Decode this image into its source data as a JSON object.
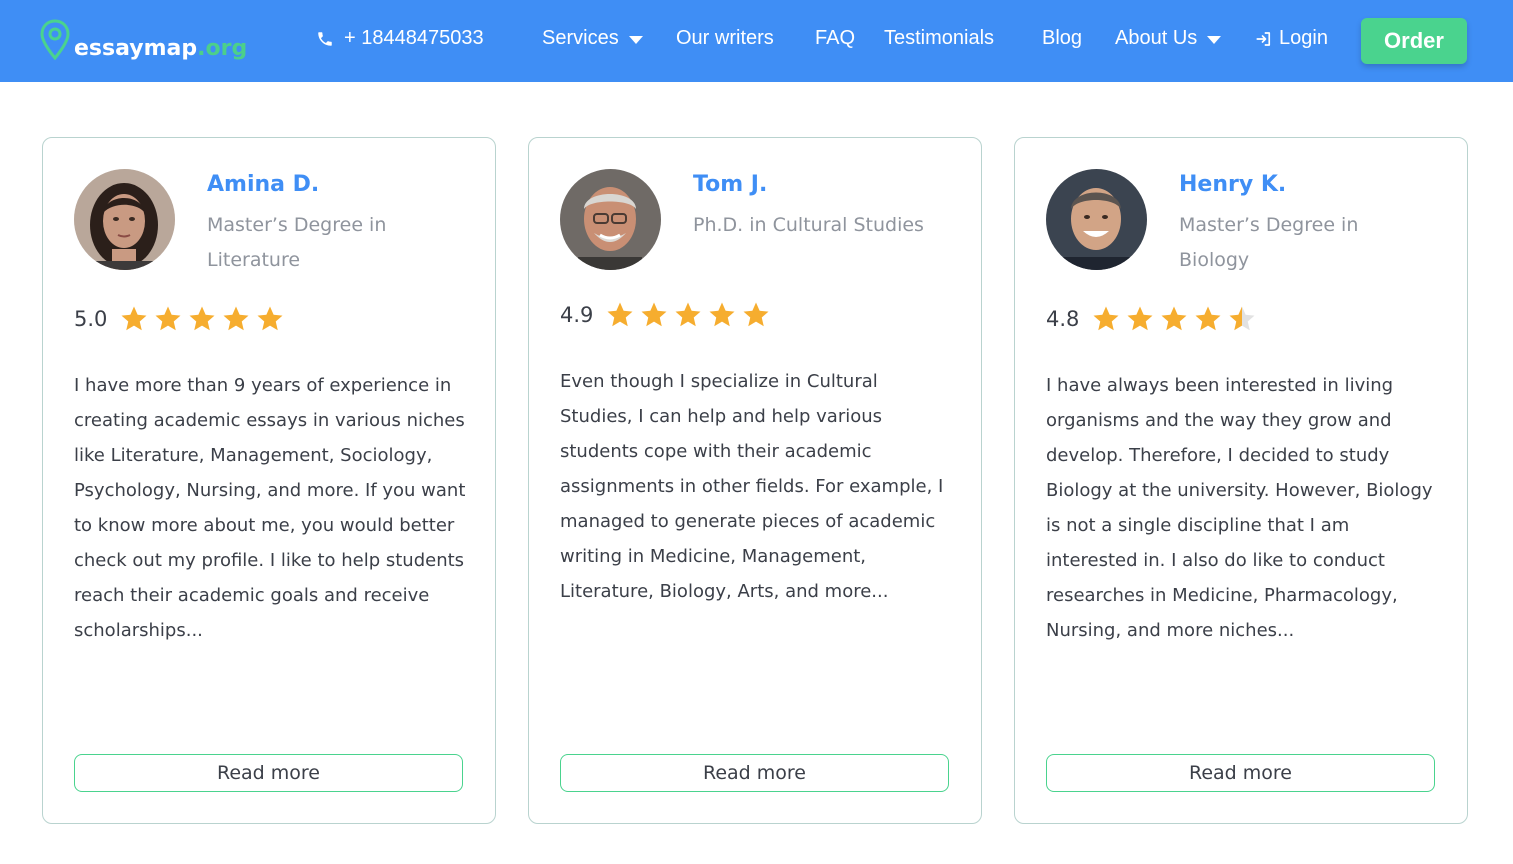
{
  "brand": {
    "logo_main": "essaymap",
    "logo_suffix": ".org",
    "accent": "#3f8ef5",
    "green": "#4ad38e"
  },
  "header": {
    "phone": "+ 18448475033",
    "nav": {
      "services": "Services",
      "writers": "Our writers",
      "faq": "FAQ",
      "testimonials": "Testimonials",
      "blog": "Blog",
      "about": "About Us",
      "login": "Login"
    },
    "order": "Order"
  },
  "writers": [
    {
      "name": "Amina D.",
      "degree": "Master’s Degree in Literature",
      "rating": "5.0",
      "stars": 5,
      "description": "I have more than 9 years of experience in creating academic essays in various niches like Literature, Management, Sociology, Psychology, Nursing, and more. If you want to know more about me, you would better check out my profile. I like to help students reach their academic goals and receive scholarships...",
      "read_more": "Read more"
    },
    {
      "name": "Tom J.",
      "degree": "Ph.D. in Cultural Studies",
      "rating": "4.9",
      "stars": 5,
      "description": "Even though I specialize in Cultural Studies, I can help and help various students cope with their academic assignments in other fields. For example, I managed to generate pieces of academic writing in Medicine, Management, Literature, Biology, Arts, and more...",
      "read_more": "Read more"
    },
    {
      "name": "Henry K.",
      "degree": "Master’s Degree in Biology",
      "rating": "4.8",
      "stars": 4.5,
      "description": "I have always been interested in living organisms and the way they grow and develop. Therefore, I decided to study Biology at the university. However, Biology is not a single discipline that I am interested in. I also do like to conduct researches in Medicine, Pharmacology, Nursing, and more niches...",
      "read_more": "Read more"
    }
  ]
}
